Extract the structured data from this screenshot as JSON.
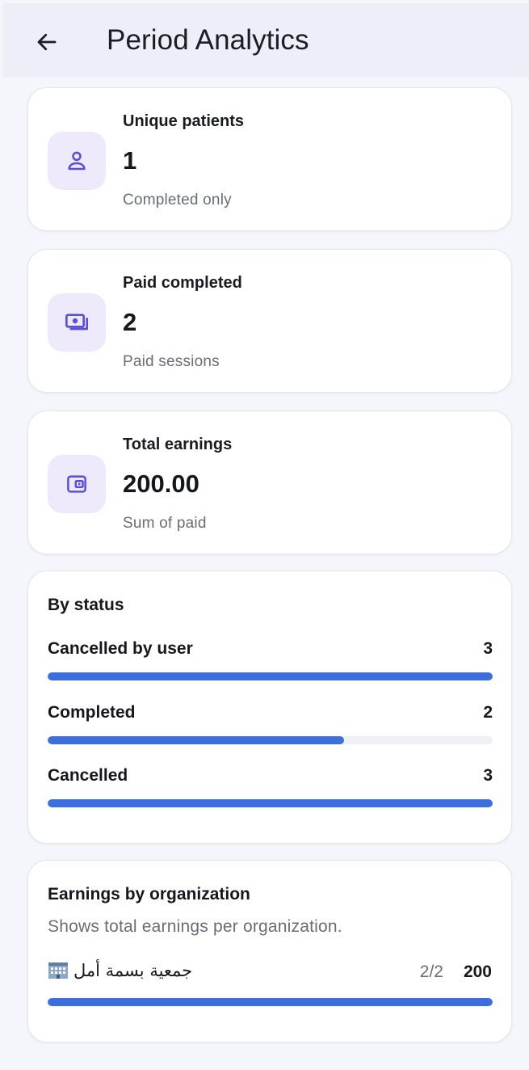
{
  "appbar": {
    "title": "Period Analytics",
    "back_icon": "arrow-left-icon"
  },
  "stats": [
    {
      "icon": "user-icon",
      "label": "Unique patients",
      "value": "1",
      "sub": "Completed only"
    },
    {
      "icon": "cash-icon",
      "label": "Paid completed",
      "value": "2",
      "sub": "Paid sessions"
    },
    {
      "icon": "wallet-icon",
      "label": "Total earnings",
      "value": "200.00",
      "sub": "Sum of paid"
    }
  ],
  "by_status": {
    "title": "By status",
    "max": 3,
    "items": [
      {
        "label": "Cancelled by user",
        "count": 3
      },
      {
        "label": "Completed",
        "count": 2
      },
      {
        "label": "Cancelled",
        "count": 3
      }
    ]
  },
  "earnings_by_org": {
    "title": "Earnings by organization",
    "description": "Shows total earnings per organization.",
    "items": [
      {
        "name": "جمعية بسمة أمل",
        "icon": "building-icon",
        "ratio": "2/2",
        "amount": "200",
        "fraction": 1.0
      }
    ]
  },
  "colors": {
    "accent": "#3d6ee0",
    "icon_tint": "#5b4fd6",
    "icon_bg": "#eeeafc",
    "appbar_bg": "#eceef8",
    "page_bg": "#f5f6fb"
  }
}
